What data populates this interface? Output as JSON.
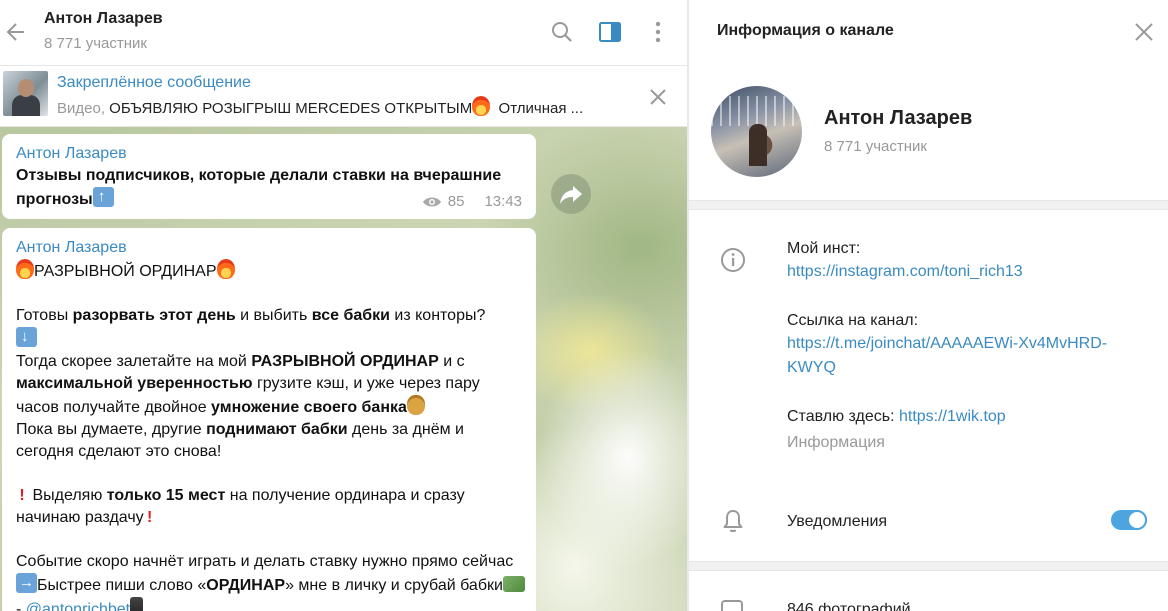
{
  "chat": {
    "title": "Антон Лазарев",
    "subtitle": "8 771 участник",
    "pinned": {
      "title": "Закреплённое сообщение",
      "kind": "Видео,",
      "text": "ОБЪЯВЛЯЮ РОЗЫГРЫШ MERCEDES ОТКРЫТЫМ",
      "tail": "Отличная ..."
    },
    "messages": [
      {
        "author": "Антон Лазарев",
        "text": "Отзывы подписчиков, которые делали ставки на вчерашние прогнозы",
        "views": "85",
        "time": "13:43"
      },
      {
        "author": "Антон Лазарев",
        "heading": "РАЗРЫВНОЙ ОРДИНАР",
        "p1_a": "Готовы ",
        "p1_b": "разорвать этот день",
        "p1_c": " и выбить ",
        "p1_d": "все бабки",
        "p1_e": " из конторы?",
        "p2_a": "Тогда скорее залетайте на мой ",
        "p2_b": "РАЗРЫВНОЙ ОРДИНАР",
        "p2_c": " и с ",
        "p2_d": "максимальной уверенностью",
        "p2_e": " грузите кэш, и уже через пару часов получайте двойное ",
        "p2_f": "умножение своего банка",
        "p3_a": "Пока вы думаете, другие ",
        "p3_b": "поднимают бабки",
        "p3_c": " день за днём и сегодня сделают это снова!",
        "p4_a": " Выделяю ",
        "p4_b": "только 15 мест",
        "p4_c": " на получение ординара и сразу начинаю раздачу",
        "p5_a": "Событие скоро начнёт играть и делать ставку нужно прямо сейчас",
        "p5_b": "Быстрее пиши слово «",
        "p5_c": "ОРДИНАР",
        "p5_d": "» мне в личку и срубай бабки",
        "p5_e": " - ",
        "p5_link": "@antonrichbet"
      }
    ]
  },
  "panel": {
    "title": "Информация о канале",
    "name": "Антон Лазарев",
    "subtitle": "8 771 участник",
    "insta_label": "Мой инст:",
    "insta_link": "https://instagram.com/toni_rich13",
    "channel_label": "Ссылка на канал:",
    "channel_link_1": "https://t.me/joinchat/AAAAAEWi-Xv4MvHRD-",
    "channel_link_2": "KWYQ",
    "bet_label": "Ставлю здесь: ",
    "bet_link": "https://1wik.top",
    "info_caption": "Информация",
    "notifications_label": "Уведомления",
    "notifications_on": true,
    "photos_label": "846 фотографий"
  },
  "colors": {
    "accent": "#3a8bc1",
    "toggle": "#4ea4de"
  }
}
